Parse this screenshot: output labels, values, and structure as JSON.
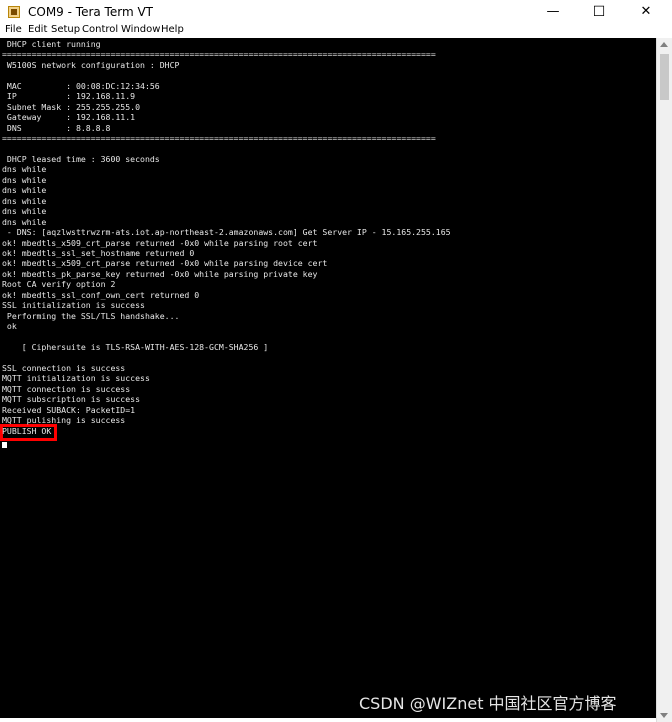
{
  "window": {
    "title": "COM9 - Tera Term VT",
    "minimize_glyph": "—",
    "maximize_glyph": "☐",
    "close_glyph": "✕"
  },
  "menu": [
    "File",
    "Edit",
    "Setup",
    "Control",
    "Window",
    "Help"
  ],
  "terminal": {
    "lines": [
      " DHCP client running",
      "========================================================================================",
      " W5100S network configuration : DHCP",
      "",
      " MAC         : 00:08:DC:12:34:56",
      " IP          : 192.168.11.9",
      " Subnet Mask : 255.255.255.0",
      " Gateway     : 192.168.11.1",
      " DNS         : 8.8.8.8",
      "========================================================================================",
      "",
      " DHCP leased time : 3600 seconds",
      "dns while",
      "dns while",
      "dns while",
      "dns while",
      "dns while",
      "dns while",
      " - DNS: [aqzlwsttrwzrm-ats.iot.ap-northeast-2.amazonaws.com] Get Server IP - 15.165.255.165",
      "ok! mbedtls_x509_crt_parse returned -0x0 while parsing root cert",
      "ok! mbedtls_ssl_set_hostname returned 0",
      "ok! mbedtls_x509_crt_parse returned -0x0 while parsing device cert",
      "ok! mbedtls_pk_parse_key returned -0x0 while parsing private key",
      "Root CA verify option 2",
      "ok! mbedtls_ssl_conf_own_cert returned 0",
      "SSL initialization is success",
      " Performing the SSL/TLS handshake...",
      " ok",
      "",
      "    [ Ciphersuite is TLS-RSA-WITH-AES-128-GCM-SHA256 ]",
      "",
      "SSL connection is success",
      "MQTT initialization is success",
      "MQTT connection is success",
      "MQTT subscription is success",
      "Received SUBACK: PacketID=1",
      "MQTT pulishing is success",
      "PUBLISH OK"
    ]
  },
  "watermark": "CSDN @WIZnet 中国社区官方博客"
}
